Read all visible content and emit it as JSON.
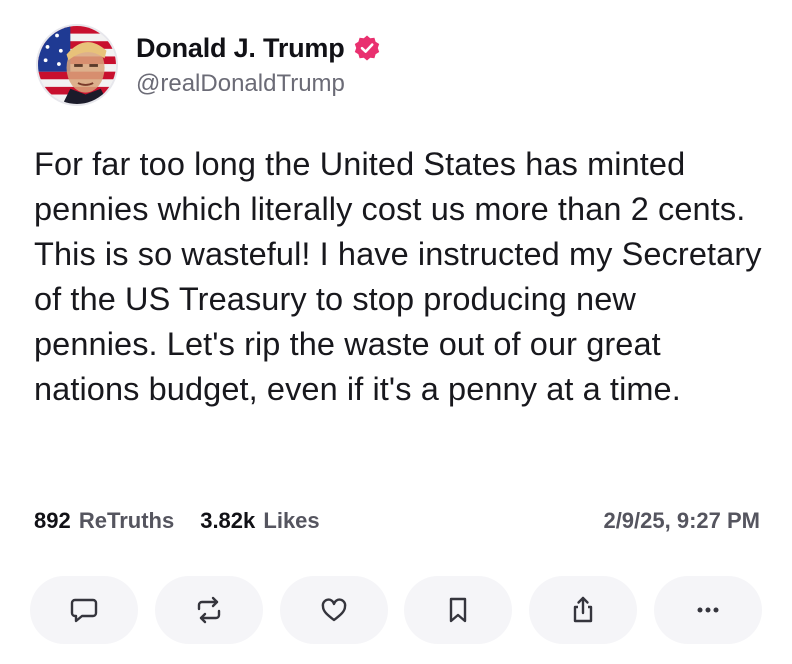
{
  "profile": {
    "display_name": "Donald J. Trump",
    "handle": "@realDonaldTrump",
    "verified_color": "#e9306f",
    "avatar_icon": "profile-photo-flag"
  },
  "post": {
    "text": "For far too long the United States has minted pennies which literally cost us more than 2 cents. This is so wasteful! I have instructed my Secretary of the US Treasury to stop producing new pennies. Let's rip the waste out of our great nations budget, even if it's a penny at a time."
  },
  "stats": {
    "retruths_count": "892",
    "retruths_label": "ReTruths",
    "likes_count": "3.82k",
    "likes_label": "Likes",
    "timestamp": "2/9/25, 9:27 PM"
  },
  "actions": [
    {
      "icon": "reply-icon"
    },
    {
      "icon": "retruth-icon"
    },
    {
      "icon": "like-icon"
    },
    {
      "icon": "bookmark-icon"
    },
    {
      "icon": "share-icon"
    },
    {
      "icon": "more-icon"
    }
  ]
}
